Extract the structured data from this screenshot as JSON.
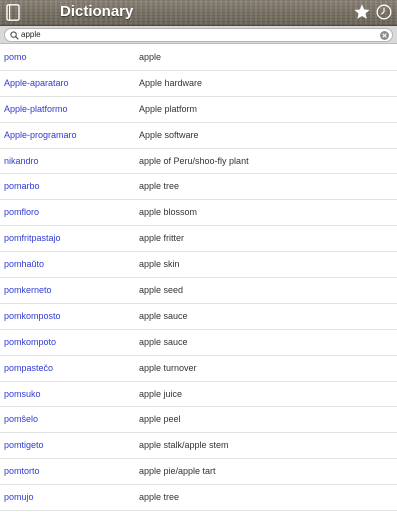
{
  "header": {
    "title": "Dictionary",
    "left_icon": "book-icon",
    "right_icons": [
      "star-icon",
      "clock-icon"
    ]
  },
  "search": {
    "value": "apple",
    "icon": "search-icon",
    "clear_icon": "clear-icon"
  },
  "colors": {
    "term_link": "#2f3bd1",
    "translation_text": "#333333",
    "header_text": "#ffffff"
  },
  "results": [
    {
      "term": "pomo",
      "translation": "apple"
    },
    {
      "term": "Apple-aparataro",
      "translation": "Apple hardware"
    },
    {
      "term": "Apple-platformo",
      "translation": "Apple platform"
    },
    {
      "term": "Apple-programaro",
      "translation": "Apple software"
    },
    {
      "term": "nikandro",
      "translation": "apple of Peru/shoo-fly plant"
    },
    {
      "term": "pomarbo",
      "translation": "apple tree"
    },
    {
      "term": "pomfloro",
      "translation": "apple blossom"
    },
    {
      "term": "pomfritpastajo",
      "translation": "apple fritter"
    },
    {
      "term": "pomhaŭto",
      "translation": "apple skin"
    },
    {
      "term": "pomkerneto",
      "translation": "apple seed"
    },
    {
      "term": "pomkomposto",
      "translation": "apple sauce"
    },
    {
      "term": "pomkompoto",
      "translation": "apple sauce"
    },
    {
      "term": "pompastečo",
      "translation": "apple turnover"
    },
    {
      "term": "pomsuko",
      "translation": "apple juice"
    },
    {
      "term": "pomŝelo",
      "translation": "apple peel"
    },
    {
      "term": "pomtigeto",
      "translation": "apple stalk/apple stem"
    },
    {
      "term": "pomtorto",
      "translation": "apple pie/apple tart"
    },
    {
      "term": "pomujo",
      "translation": "apple tree"
    }
  ]
}
